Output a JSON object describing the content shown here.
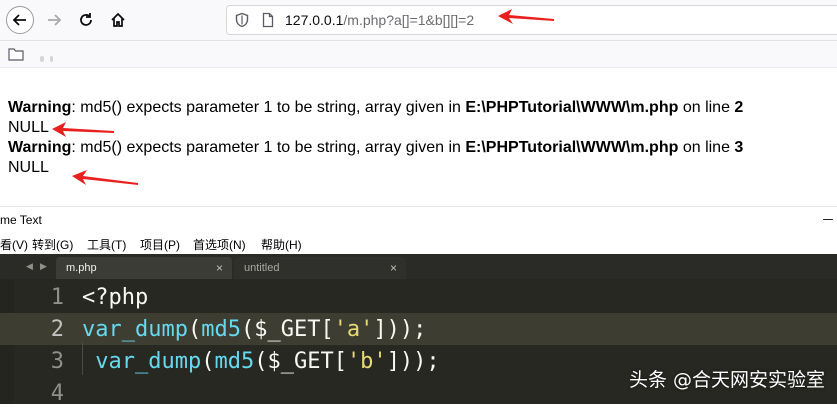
{
  "browser": {
    "url_host": "127.0.0.1",
    "url_path": "/m.php?a[]=1&b[][]=2"
  },
  "page_output": [
    {
      "label": "Warning",
      "text": ": md5() expects parameter 1 to be string, array given in ",
      "file": "E:\\PHPTutorial\\WWW\\m.php",
      "on_line": " on line ",
      "line_no": "2"
    },
    {
      "null": "NULL"
    },
    {
      "label": "Warning",
      "text": ": md5() expects parameter 1 to be string, array given in ",
      "file": "E:\\PHPTutorial\\WWW\\m.php",
      "on_line": " on line ",
      "line_no": "3"
    },
    {
      "null": "NULL"
    }
  ],
  "editor": {
    "title": "me Text",
    "menu": [
      "看(V)",
      "转到(G)",
      "工具(T)",
      "项目(P)",
      "首选项(N)",
      "帮助(H)"
    ],
    "tabs": [
      {
        "label": "m.php",
        "close": "×",
        "active": true
      },
      {
        "label": "untitled",
        "close": "×",
        "active": false
      }
    ],
    "tab_nav_left": "◀",
    "tab_nav_right": "▶",
    "lines": [
      {
        "num": "1",
        "parts": [
          "<?php"
        ]
      },
      {
        "num": "2",
        "parts": [
          "var_dump",
          "(",
          "md5",
          "($_GET[",
          "'a'",
          "]));"
        ]
      },
      {
        "num": "3",
        "parts": [
          " var_dump",
          "(",
          "md5",
          "($_GET[",
          "'b'",
          "]));"
        ]
      },
      {
        "num": "4",
        "parts": []
      }
    ],
    "current_line": 2
  },
  "colors": {
    "editor_bg": "#272822",
    "keyword": "#66d9ef",
    "string": "#e6db74",
    "arrow": "#e8201e"
  },
  "watermark": "头条 @合天网安实验室"
}
